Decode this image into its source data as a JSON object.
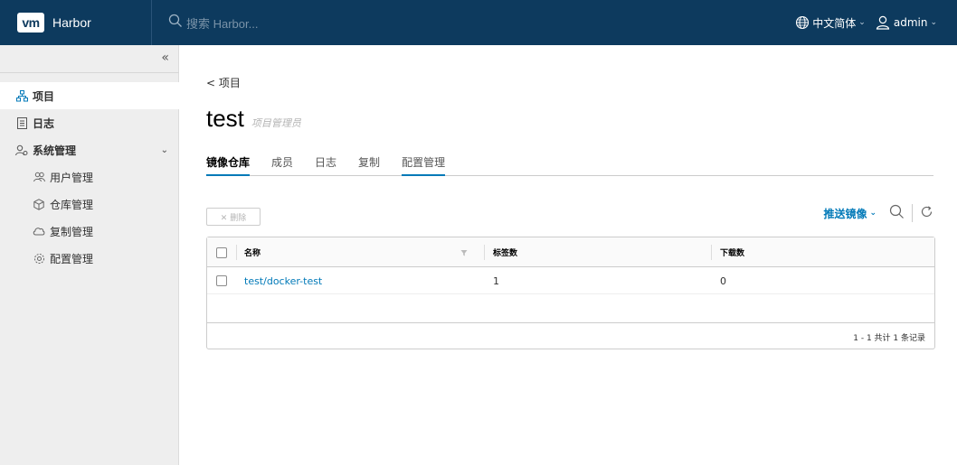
{
  "header": {
    "logo_text": "vm",
    "brand": "Harbor",
    "search_placeholder": "搜索 Harbor...",
    "language": "中文简体",
    "user": "admin",
    "caret": "⌄"
  },
  "sidebar": {
    "collapse": "«",
    "items": [
      {
        "label": "项目",
        "icon": "project-icon"
      },
      {
        "label": "日志",
        "icon": "log-icon"
      },
      {
        "label": "系统管理",
        "icon": "admin-icon",
        "chevron": "⌄"
      },
      {
        "label": "用户管理",
        "icon": "users-icon"
      },
      {
        "label": "仓库管理",
        "icon": "registry-icon"
      },
      {
        "label": "复制管理",
        "icon": "replication-icon"
      },
      {
        "label": "配置管理",
        "icon": "config-icon"
      }
    ]
  },
  "main": {
    "back_link": "< 项目",
    "project_title": "test",
    "role": "项目管理员",
    "tabs": [
      "镜像仓库",
      "成员",
      "日志",
      "复制",
      "配置管理"
    ],
    "delete_button": "✕ 删除",
    "push_button": "推送镜像"
  },
  "table": {
    "columns": [
      "名称",
      "标签数",
      "下载数"
    ],
    "rows": [
      {
        "name": "test/docker-test",
        "tags": "1",
        "pulls": "0"
      }
    ],
    "footer": "1 - 1 共计 1 条记录"
  },
  "colors": {
    "header_bg": "#0d3a5e",
    "accent": "#0079b8",
    "sidebar_bg": "#eeeeee"
  }
}
